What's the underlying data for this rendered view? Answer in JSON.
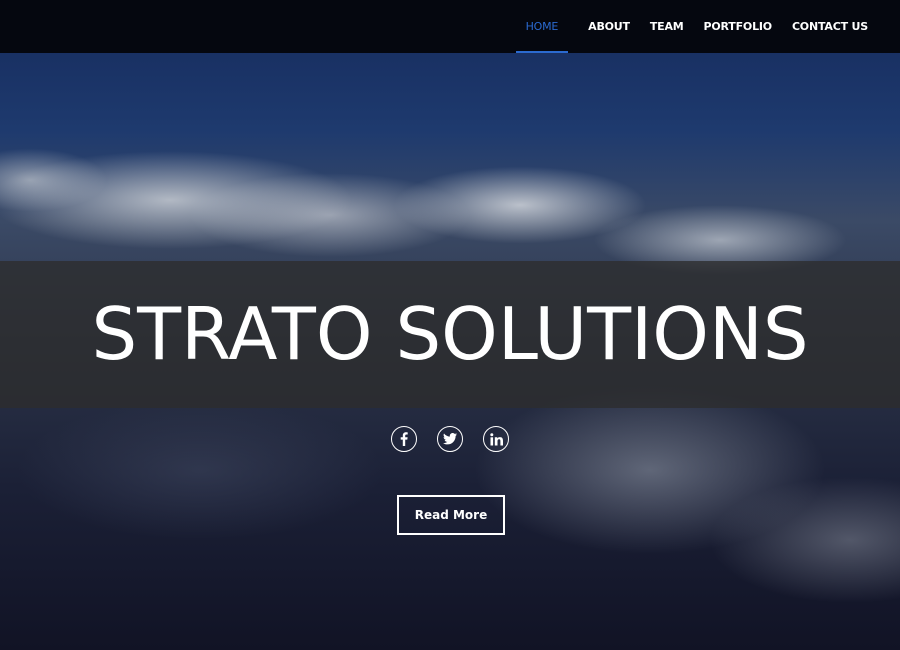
{
  "nav": {
    "items": [
      {
        "label": "HOME",
        "active": true
      },
      {
        "label": "ABOUT",
        "active": false
      },
      {
        "label": "TEAM",
        "active": false
      },
      {
        "label": "PORTFOLIO",
        "active": false
      },
      {
        "label": "CONTACT US",
        "active": false
      }
    ]
  },
  "hero": {
    "title": "STRATO SOLUTIONS",
    "social": [
      {
        "icon": "facebook-icon"
      },
      {
        "icon": "twitter-icon"
      },
      {
        "icon": "linkedin-icon"
      }
    ],
    "cta_label": "Read More"
  },
  "colors": {
    "accent": "#2b6ad0",
    "navbar": "#05070f",
    "band": "#2d2d2d"
  }
}
